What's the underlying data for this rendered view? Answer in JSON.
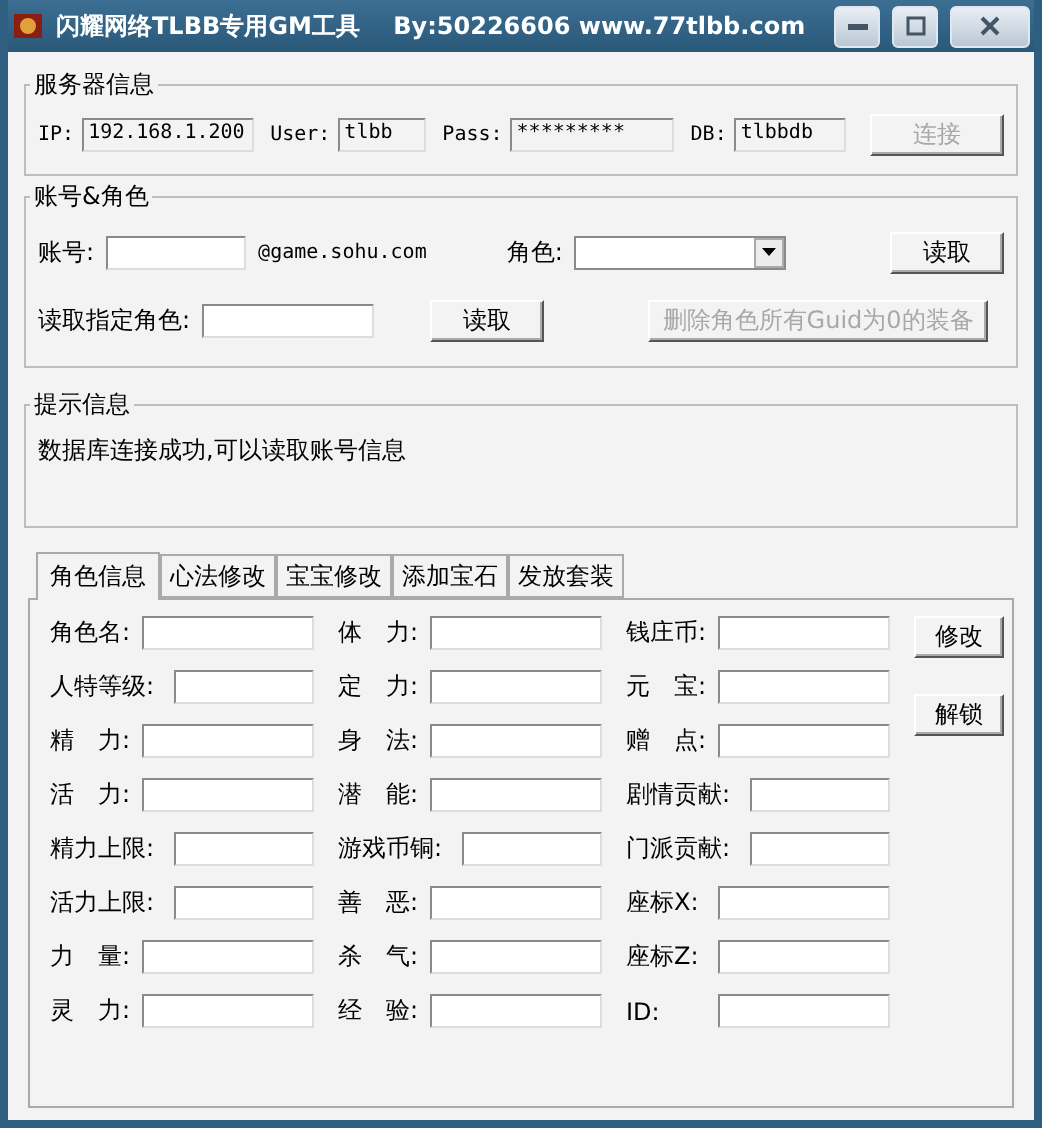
{
  "window": {
    "title": "闪耀网络TLBB专用GM工具    By:50226606 www.77tlbb.com"
  },
  "server": {
    "title": "服务器信息",
    "fields": [
      {
        "label": "IP:",
        "value": "192.168.1.200"
      },
      {
        "label": "User:",
        "value": "tlbb"
      },
      {
        "label": "Pass:",
        "value": "*********"
      },
      {
        "label": "DB:",
        "value": "tlbbdb"
      }
    ],
    "button": {
      "label": "连接",
      "disabled": true
    }
  },
  "account": {
    "title": "账号&角色",
    "account_label": "账号:",
    "domain": "@game.sohu.com",
    "role_label": "角色:",
    "read_button": {
      "label": "读取",
      "disabled": false
    },
    "specific_label": "读取指定角色:",
    "specific_button": {
      "label": "读取",
      "disabled": false
    },
    "delete_button": {
      "label": "删除角色所有Guid为0的装备",
      "disabled": true
    }
  },
  "hint": {
    "title": "提示信息",
    "message": "数据库连接成功,可以读取账号信息"
  },
  "tabs": [
    {
      "label": "角色信息",
      "selected": true
    },
    {
      "label": "心法修改",
      "selected": false
    },
    {
      "label": "宝宝修改",
      "selected": false
    },
    {
      "label": "添加宝石",
      "selected": false
    },
    {
      "label": "发放套装",
      "selected": false
    }
  ],
  "role_rows": [
    [
      {
        "label": "角色名:"
      },
      {
        "label": "体　力:"
      },
      {
        "label": "钱庄币:"
      }
    ],
    [
      {
        "label": "人特等级:"
      },
      {
        "label": "定　力:"
      },
      {
        "label": "元　宝:"
      }
    ],
    [
      {
        "label": "精　力:"
      },
      {
        "label": "身　法:"
      },
      {
        "label": "赠　点:"
      }
    ],
    [
      {
        "label": "活　力:"
      },
      {
        "label": "潜　能:"
      },
      {
        "label": "剧情贡献:"
      }
    ],
    [
      {
        "label": "精力上限:"
      },
      {
        "label": "游戏币铜:"
      },
      {
        "label": "门派贡献:"
      }
    ],
    [
      {
        "label": "活力上限:"
      },
      {
        "label": "善　恶:"
      },
      {
        "label": "座标X:"
      }
    ],
    [
      {
        "label": "力　量:"
      },
      {
        "label": "杀　气:"
      },
      {
        "label": "座标Z:"
      }
    ],
    [
      {
        "label": "灵　力:"
      },
      {
        "label": "经　验:"
      },
      {
        "label": "ID:"
      }
    ]
  ],
  "role_buttons": [
    {
      "label": "修改",
      "disabled": false
    },
    {
      "label": "解锁",
      "disabled": false
    }
  ]
}
